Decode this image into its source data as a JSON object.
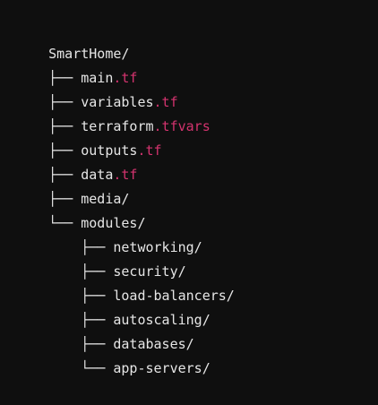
{
  "tree": {
    "root": "SmartHome/",
    "items": [
      {
        "prefix": "├── ",
        "name": "main",
        "ext": ".tf"
      },
      {
        "prefix": "├── ",
        "name": "variables",
        "ext": ".tf"
      },
      {
        "prefix": "├── ",
        "name": "terraform",
        "ext": ".tfvars"
      },
      {
        "prefix": "├── ",
        "name": "outputs",
        "ext": ".tf"
      },
      {
        "prefix": "├── ",
        "name": "data",
        "ext": ".tf"
      },
      {
        "prefix": "├── ",
        "name": "media/",
        "ext": ""
      },
      {
        "prefix": "└── ",
        "name": "modules/",
        "ext": ""
      },
      {
        "prefix": "    ├── ",
        "name": "networking/",
        "ext": ""
      },
      {
        "prefix": "    ├── ",
        "name": "security/",
        "ext": ""
      },
      {
        "prefix": "    ├── ",
        "name": "load-balancers/",
        "ext": ""
      },
      {
        "prefix": "    ├── ",
        "name": "autoscaling/",
        "ext": ""
      },
      {
        "prefix": "    ├── ",
        "name": "databases/",
        "ext": ""
      },
      {
        "prefix": "    └── ",
        "name": "app-servers/",
        "ext": ""
      }
    ]
  },
  "colors": {
    "background": "#0f0f0f",
    "text": "#e6e6e6",
    "extension_accent": "#d3336e"
  }
}
